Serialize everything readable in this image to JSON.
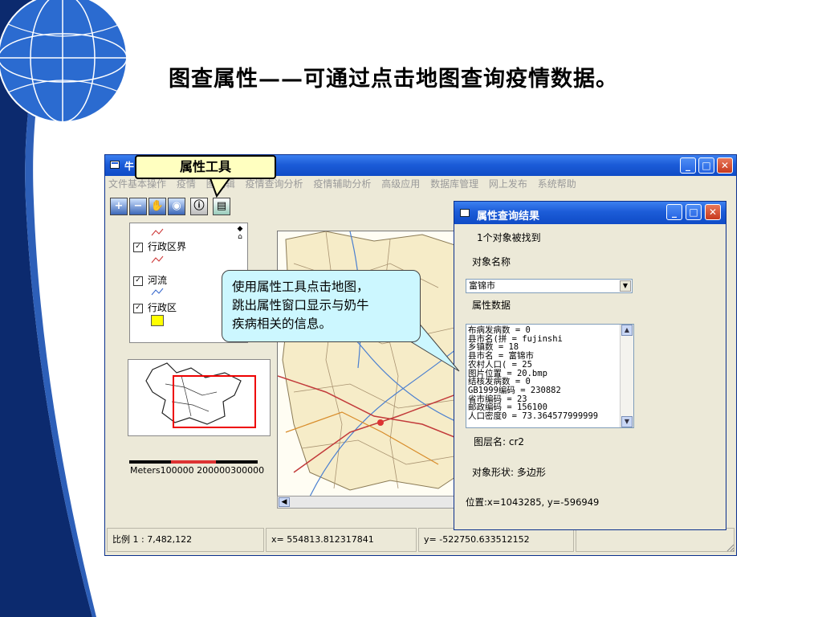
{
  "slide": {
    "title": "图查属性——可通过点击地图查询疫情数据。"
  },
  "main_window": {
    "title": "牛",
    "menu": [
      "文件基本操作",
      "疫情",
      "图编辑",
      "疫情查询分析",
      "疫情辅助分析",
      "高级应用",
      "数据库管理",
      "网上发布",
      "系统帮助"
    ],
    "toolbar_icons": [
      "zoom-in-icon",
      "zoom-out-icon",
      "pan-hand-icon",
      "full-extent-icon",
      "attribute-tool-icon",
      "print-icon"
    ],
    "legend": [
      {
        "label": "行政区界",
        "checked": true
      },
      {
        "label": "河流",
        "checked": true
      },
      {
        "label": "行政区",
        "checked": true
      }
    ],
    "scale_text": "Meters100000   200000300000",
    "status": {
      "scale": "比例  1 : 7,482,122",
      "x": "x= 554813.812317841",
      "y": "y= -522750.633512152"
    }
  },
  "callouts": {
    "tool": "属性工具",
    "info_lines": [
      "使用属性工具点击地图，",
      "跳出属性窗口显示与奶牛",
      "疾病相关的信息。"
    ]
  },
  "result_window": {
    "title": "属性查询结果",
    "found": "1个对象被找到",
    "name_label": "对象名称",
    "selected_name": "富锦市",
    "attr_label": "属性数据",
    "attributes": [
      "布病发病数 = 0",
      "县市名(拼 = fujinshi",
      "乡镇数 = 18",
      "县市名 = 富锦市",
      "农村人口( = 25",
      "图片位置 = 20.bmp",
      "结核发病数 = 0",
      "GB1999编码 = 230882",
      "省市编码 = 23",
      "邮政编码 = 156100",
      "人口密度0 = 73.364577999999"
    ],
    "layer": "图层名:  cr2",
    "shape": "对象形状:  多边形",
    "position": "位置:x=1043285, y=-596949"
  },
  "colors": {
    "titlebar": "#1c5cd8",
    "callout_yellow": "#ffffc0",
    "callout_cyan": "#ccf7ff",
    "stripe": "#0c2a6e"
  }
}
